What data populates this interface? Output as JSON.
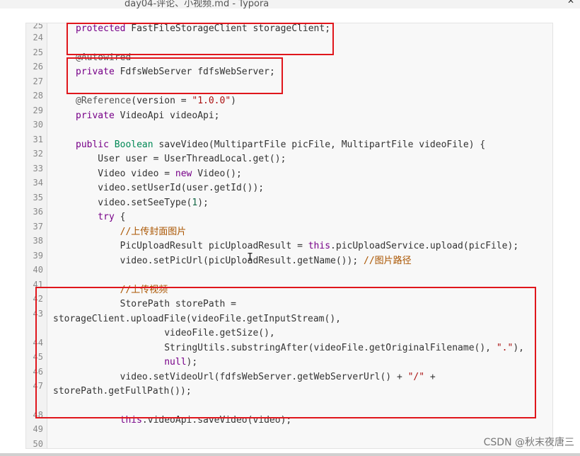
{
  "window": {
    "title": "day04-评论、小视频.md - Typora",
    "close_glyph": "✕"
  },
  "code": {
    "line_numbers": [
      "25",
      "24",
      "25",
      "26",
      "27",
      "28",
      "29",
      "30",
      "31",
      "32",
      "33",
      "34",
      "35",
      "36",
      "37",
      "38",
      "39",
      "40",
      "41",
      "42",
      "43",
      "44",
      "45",
      "46",
      "47",
      "48",
      "49",
      "50"
    ]
  },
  "watermark": "CSDN @秋末夜唐三"
}
